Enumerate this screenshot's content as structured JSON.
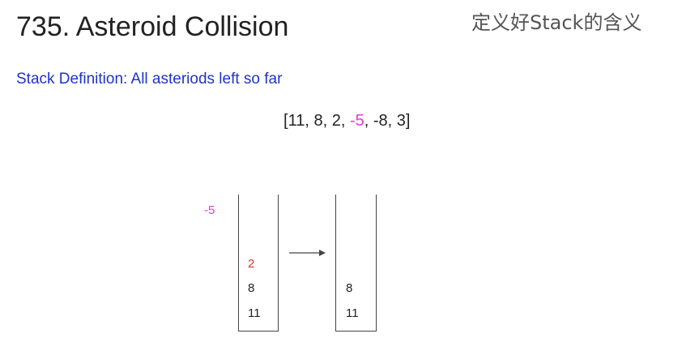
{
  "title": "735. Asteroid Collision",
  "subtitle": "定义好Stack的含义",
  "definition": "Stack Definition: All asteriods left so far",
  "array": {
    "open": "[",
    "before": [
      "11",
      "8",
      "2"
    ],
    "highlight": "-5",
    "after": [
      "-8",
      "3"
    ],
    "close": "]"
  },
  "incoming": "-5",
  "stacks": {
    "before": [
      "2",
      "8",
      "11"
    ],
    "after": [
      "8",
      "11"
    ]
  },
  "colors": {
    "highlight": "#e03be0",
    "collided": "#e03226",
    "definition": "#1f33c8"
  }
}
